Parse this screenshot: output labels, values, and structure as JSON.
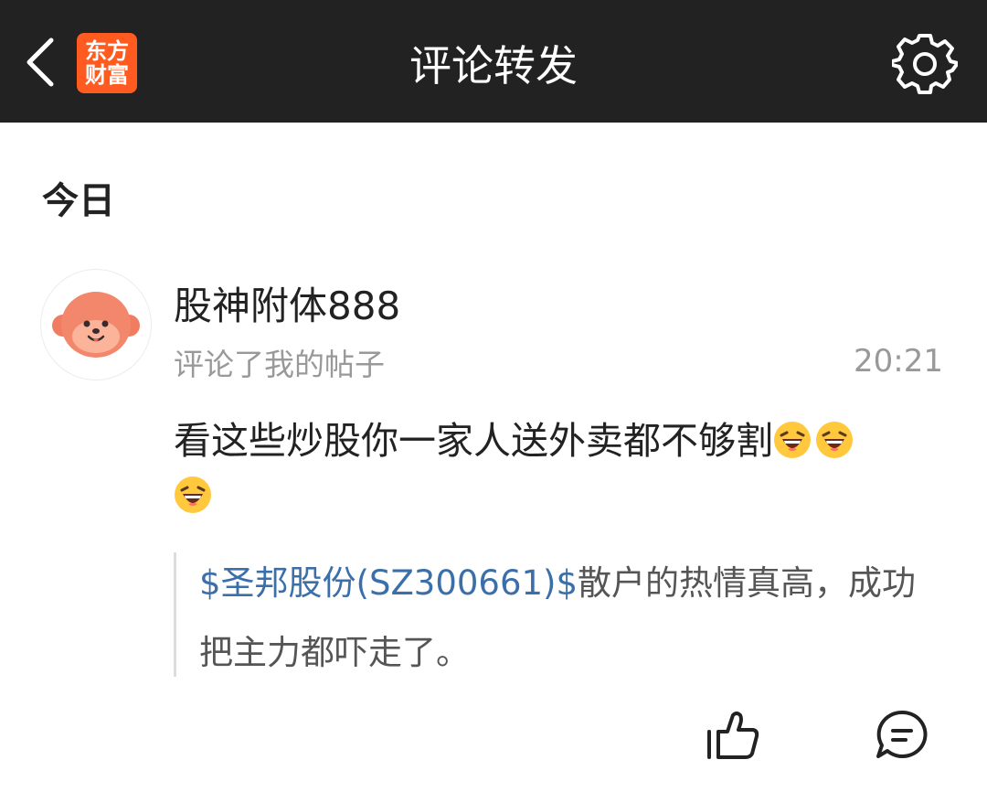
{
  "header": {
    "title": "评论转发",
    "logo_line1": "东方",
    "logo_line2": "财富",
    "back_icon": "chevron-left-icon",
    "settings_icon": "gear-icon"
  },
  "section": {
    "title": "今日"
  },
  "notification": {
    "avatar_icon": "monkey-avatar-icon",
    "username": "股神附体888",
    "action": "评论了我的帖子",
    "time": "20:21",
    "comment_text": "看这些炒股你一家人送外卖都不够割",
    "emoji_icons": [
      "laughing-emoji-icon",
      "laughing-emoji-icon",
      "laughing-emoji-icon"
    ],
    "quoted_post": {
      "stock_link": "$圣邦股份(SZ300661)$",
      "text": "散户的热情真高，成功把主力都吓走了。"
    }
  },
  "actions": {
    "like_icon": "thumbs-up-icon",
    "reply_icon": "comment-bubble-icon"
  },
  "colors": {
    "header_bg": "#222222",
    "brand": "#ff5a1f",
    "link": "#3b6faa",
    "muted_text": "#999999"
  }
}
